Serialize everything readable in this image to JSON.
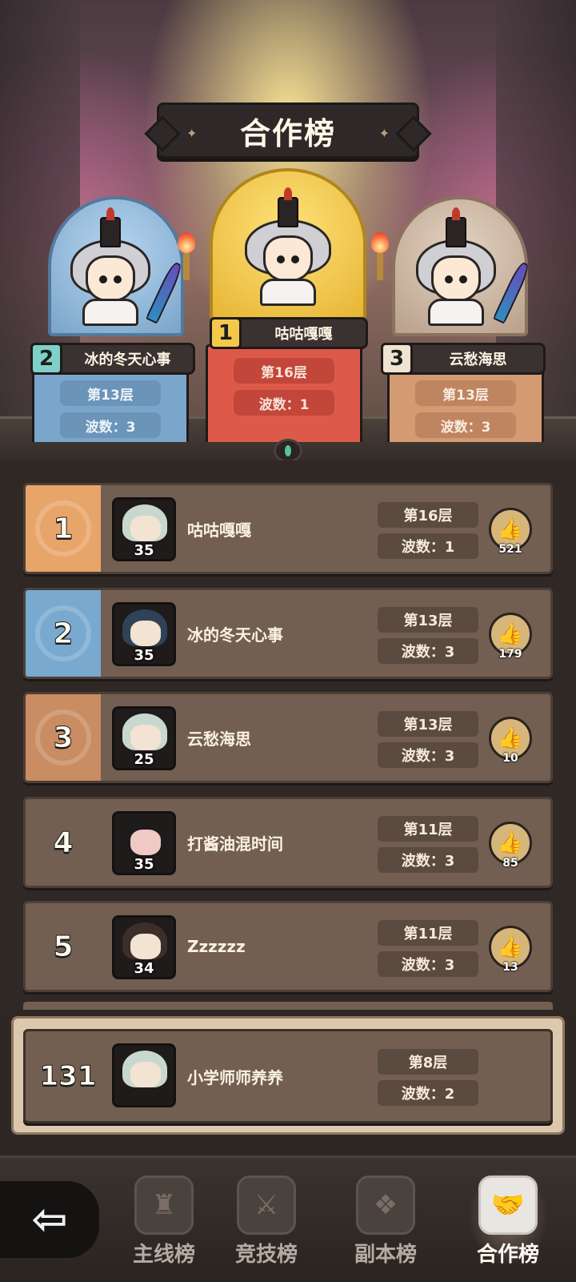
{
  "title": "合作榜",
  "podium": [
    {
      "rank": "1",
      "name": "咕咕嘎嘎",
      "floor": "第16层",
      "wave": "波数：1"
    },
    {
      "rank": "2",
      "name": "冰的冬天心事",
      "floor": "第13层",
      "wave": "波数：3"
    },
    {
      "rank": "3",
      "name": "云愁海思",
      "floor": "第13层",
      "wave": "波数：3"
    }
  ],
  "rows": [
    {
      "rank": "1",
      "name": "咕咕嘎嘎",
      "level": "35",
      "floor": "第16层",
      "wave": "波数：1",
      "likes": "521"
    },
    {
      "rank": "2",
      "name": "冰的冬天心事",
      "level": "35",
      "floor": "第13层",
      "wave": "波数：3",
      "likes": "179"
    },
    {
      "rank": "3",
      "name": "云愁海思",
      "level": "25",
      "floor": "第13层",
      "wave": "波数：3",
      "likes": "10"
    },
    {
      "rank": "4",
      "name": "打酱油混时间",
      "level": "35",
      "floor": "第11层",
      "wave": "波数：3",
      "likes": "85"
    },
    {
      "rank": "5",
      "name": "Zzzzzz",
      "level": "34",
      "floor": "第11层",
      "wave": "波数：3",
      "likes": "13"
    }
  ],
  "self": {
    "rank": "131",
    "name": "小学师师养养",
    "floor": "第8层",
    "wave": "波数：2"
  },
  "nav": {
    "tabs": [
      {
        "label": "主线榜",
        "icon": "tower-icon"
      },
      {
        "label": "竞技榜",
        "icon": "crossed-swords-icon"
      },
      {
        "label": "副本榜",
        "icon": "gate-icon"
      },
      {
        "label": "合作榜",
        "icon": "handshake-icon"
      }
    ],
    "active": "合作榜",
    "back_icon": "back-arrow-icon"
  },
  "colors": {
    "rank1": "#e8a56a",
    "rank2": "#79a9cf",
    "rank3": "#c98c63",
    "row_bg": "#735f52"
  }
}
